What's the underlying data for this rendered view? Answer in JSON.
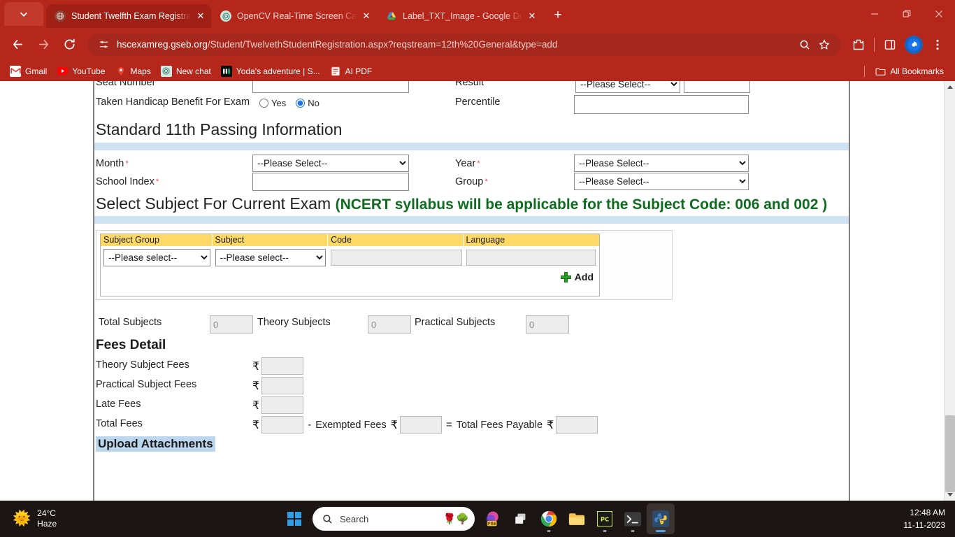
{
  "browser": {
    "tabs": [
      {
        "title": "Student Twelfth Exam Registrati",
        "favicon": "globe-icon",
        "active": true
      },
      {
        "title": "OpenCV Real-Time Screen Capt",
        "favicon": "chatgpt-icon",
        "active": false
      },
      {
        "title": "Label_TXT_Image - Google Driv",
        "favicon": "google-drive-icon",
        "active": false
      }
    ],
    "new_tab_label": "+",
    "tab_close_label": "✕",
    "url_domain": "hscexamreg.gseb.org",
    "url_path": "/Student/TwelvethStudentRegistration.aspx?reqstream=12th%20General&type=add",
    "bookmarks": [
      {
        "label": "Gmail",
        "icon": "gmail-icon"
      },
      {
        "label": "YouTube",
        "icon": "youtube-icon"
      },
      {
        "label": "Maps",
        "icon": "maps-icon"
      },
      {
        "label": "New chat",
        "icon": "chatgpt-icon"
      },
      {
        "label": "Yoda's adventure | S...",
        "icon": "dark-square-icon"
      },
      {
        "label": "AI PDF",
        "icon": "pdf-icon"
      }
    ],
    "all_bookmarks_label": "All Bookmarks",
    "theme_color": "#b5271a"
  },
  "page": {
    "clipped_row": {
      "seat_number_label": "Seat Number",
      "result_label": "Result",
      "result_value": "--Please Select--"
    },
    "handicap": {
      "label": "Taken Handicap Benefit For Exam",
      "yes_label": "Yes",
      "no_label": "No",
      "selected": "No"
    },
    "percentile": {
      "label": "Percentile",
      "value": ""
    },
    "section_std11": "Standard 11th Passing Information",
    "std11_fields": {
      "month_label": "Month",
      "month_value": "--Please Select--",
      "year_label": "Year",
      "year_value": "--Please Select--",
      "school_index_label": "School Index",
      "school_index_value": "",
      "group_label": "Group",
      "group_value": "--Please Select--"
    },
    "section_subject_main": "Select Subject For Current Exam ",
    "section_subject_note": "(NCERT syllabus will be applicable for the Subject Code: 006 and 002 )",
    "subject_table": {
      "headers": [
        "Subject Group",
        "Subject",
        "Code",
        "Language"
      ],
      "row": {
        "subject_group_value": "--Please select--",
        "subject_value": "--Please select--",
        "code_value": "",
        "language_value": ""
      },
      "add_label": "Add",
      "add_icon": "plus-icon",
      "header_bg": "#ffd966"
    },
    "totals": {
      "total_subjects_label": "Total Subjects",
      "total_subjects_value": "0",
      "theory_subjects_label": "Theory Subjects",
      "theory_subjects_value": "0",
      "practical_subjects_label": "Practical Subjects",
      "practical_subjects_value": "0"
    },
    "fees_heading": "Fees Detail",
    "fees": {
      "currency": "₹",
      "theory_label": "Theory Subject Fees",
      "theory_value": "",
      "practical_label": "Practical Subject Fees",
      "practical_value": "",
      "late_label": "Late Fees",
      "late_value": "",
      "total_label": "Total Fees",
      "total_value": "",
      "minus_op": "-",
      "exempted_label": "Exempted Fees",
      "exempted_value": "",
      "equals_op": "=",
      "payable_label": "Total Fees Payable",
      "payable_value": ""
    },
    "upload_heading": "Upload Attachments",
    "required_mark": "*",
    "section_bar_color": "#cfe2f3"
  },
  "taskbar": {
    "weather_temp": "24°C",
    "weather_cond": "Haze",
    "weather_icon": "haze-icon",
    "start_label": "windows-logo",
    "search_placeholder": "Search",
    "apps": [
      {
        "name": "premiere-pro",
        "glyph": "Pr",
        "active": false,
        "running": false
      },
      {
        "name": "task-view",
        "glyph": "▣",
        "active": false,
        "running": false
      },
      {
        "name": "google-chrome",
        "glyph": "chrome",
        "active": false,
        "running": true
      },
      {
        "name": "file-explorer",
        "glyph": "folder",
        "active": false,
        "running": false
      },
      {
        "name": "pycharm",
        "glyph": "PC",
        "active": false,
        "running": true
      },
      {
        "name": "terminal",
        "glyph": ">_",
        "active": false,
        "running": true
      },
      {
        "name": "python",
        "glyph": "python",
        "active": true,
        "running": true
      }
    ],
    "time": "12:48 AM",
    "date": "11-11-2023"
  }
}
